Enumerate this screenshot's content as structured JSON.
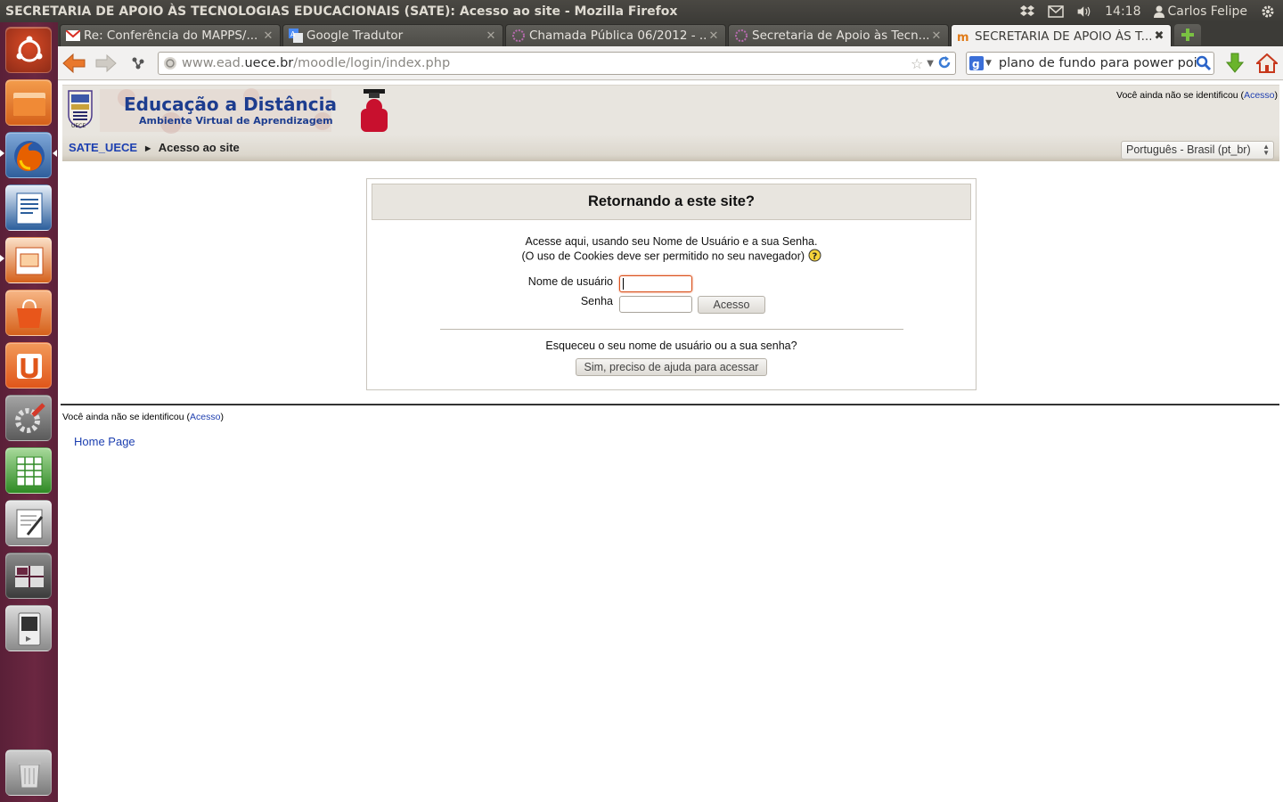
{
  "window": {
    "title": "SECRETARIA DE APOIO ÀS TECNOLOGIAS EDUCACIONAIS (SATE): Acesso ao site - Mozilla Firefox"
  },
  "tray": {
    "time": "14:18",
    "user": "Carlos Felipe"
  },
  "tabs": [
    {
      "label": "Re: Conferência do MAPPS/...",
      "icon": "gmail-icon"
    },
    {
      "label": "Google Tradutor",
      "icon": "translate-icon"
    },
    {
      "label": "Chamada Pública 06/2012 - ...",
      "icon": "site-icon"
    },
    {
      "label": "Secretaria de Apoio às Tecn...",
      "icon": "site-icon"
    },
    {
      "label": "SECRETARIA DE APOIO ÀS T...",
      "icon": "moodle-icon",
      "active": true
    }
  ],
  "navbar": {
    "url_prefix": "www.ead.",
    "url_host": "uece.br",
    "url_path": "/moodle/login/index.php",
    "search_value": "plano de fundo para power point"
  },
  "site": {
    "banner_title": "Educação a Distância",
    "banner_subtitle": "Ambiente Virtual de Aprendizagem",
    "logo_text": "UECE",
    "login_info_prefix": "Você ainda não se identificou (",
    "login_info_link": "Acesso",
    "login_info_suffix": ")",
    "breadcrumb_home": "SATE_UECE",
    "breadcrumb_sep": "►",
    "breadcrumb_current": "Acesso ao site",
    "language": "Português - Brasil (pt_br)"
  },
  "login": {
    "heading": "Retornando a este site?",
    "intro_line1": "Acesse aqui, usando seu Nome de Usuário e a sua Senha.",
    "intro_line2": "(O uso de Cookies deve ser permitido no seu navegador)",
    "username_label": "Nome de usuário",
    "password_label": "Senha",
    "submit_label": "Acesso",
    "forgot_text": "Esqueceu o seu nome de usuário ou a sua senha?",
    "forgot_button": "Sim, preciso de ajuda para acessar"
  },
  "footer": {
    "login_info_prefix": "Você ainda não se identificou (",
    "login_info_link": "Acesso",
    "login_info_suffix": ")",
    "home_link": "Home Page"
  },
  "colors": {
    "launcher": "#6b2741",
    "panel": "#3c3b37",
    "link": "#1c3fb0",
    "header_bg": "#e8e5df",
    "focus_border": "#d9501c"
  }
}
